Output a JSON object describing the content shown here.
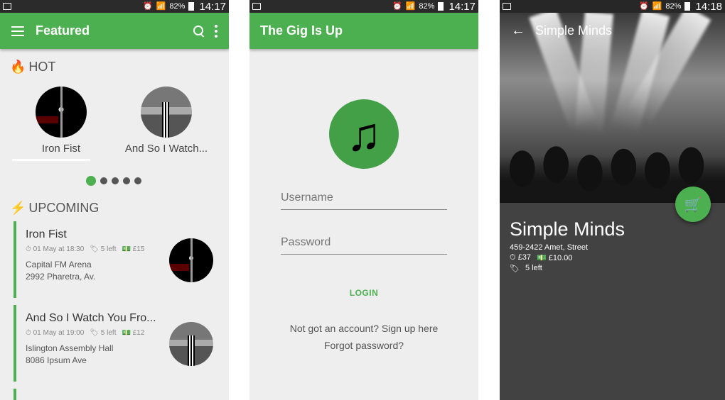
{
  "status": {
    "battery": "82%",
    "time_1": "14:17",
    "time_2": "14:17",
    "time_3": "14:18"
  },
  "screen1": {
    "title": "Featured",
    "hot_label": "HOT",
    "hot_items": [
      {
        "label": "Iron Fist"
      },
      {
        "label": "And So I Watch..."
      }
    ],
    "upcoming_label": "UPCOMING",
    "cards": [
      {
        "title": "Iron Fist",
        "date": "01 May at 18:30",
        "left": "5 left",
        "price": "£15",
        "venue": "Capital FM Arena",
        "address": "2992 Pharetra, Av."
      },
      {
        "title": "And So I Watch You Fro...",
        "date": "01 May at 19:00",
        "left": "5 left",
        "price": "£12",
        "venue": "Islington Assembly Hall",
        "address": "8086 Ipsum Ave"
      }
    ]
  },
  "screen2": {
    "title": "The Gig Is Up",
    "username_placeholder": "Username",
    "password_placeholder": "Password",
    "login_label": "LOGIN",
    "signup_link": "Not got an account? Sign up here",
    "forgot_link": "Forgot password?"
  },
  "screen3": {
    "title": "Simple Minds",
    "band_name": "Simple Minds",
    "address": "459-2422 Amet, Street",
    "price_1": "£37",
    "price_2": "£10.00",
    "left": "5 left"
  },
  "colors": {
    "accent": "#4caf50",
    "accent_dark": "#43a047",
    "detail_bg": "#424242"
  }
}
